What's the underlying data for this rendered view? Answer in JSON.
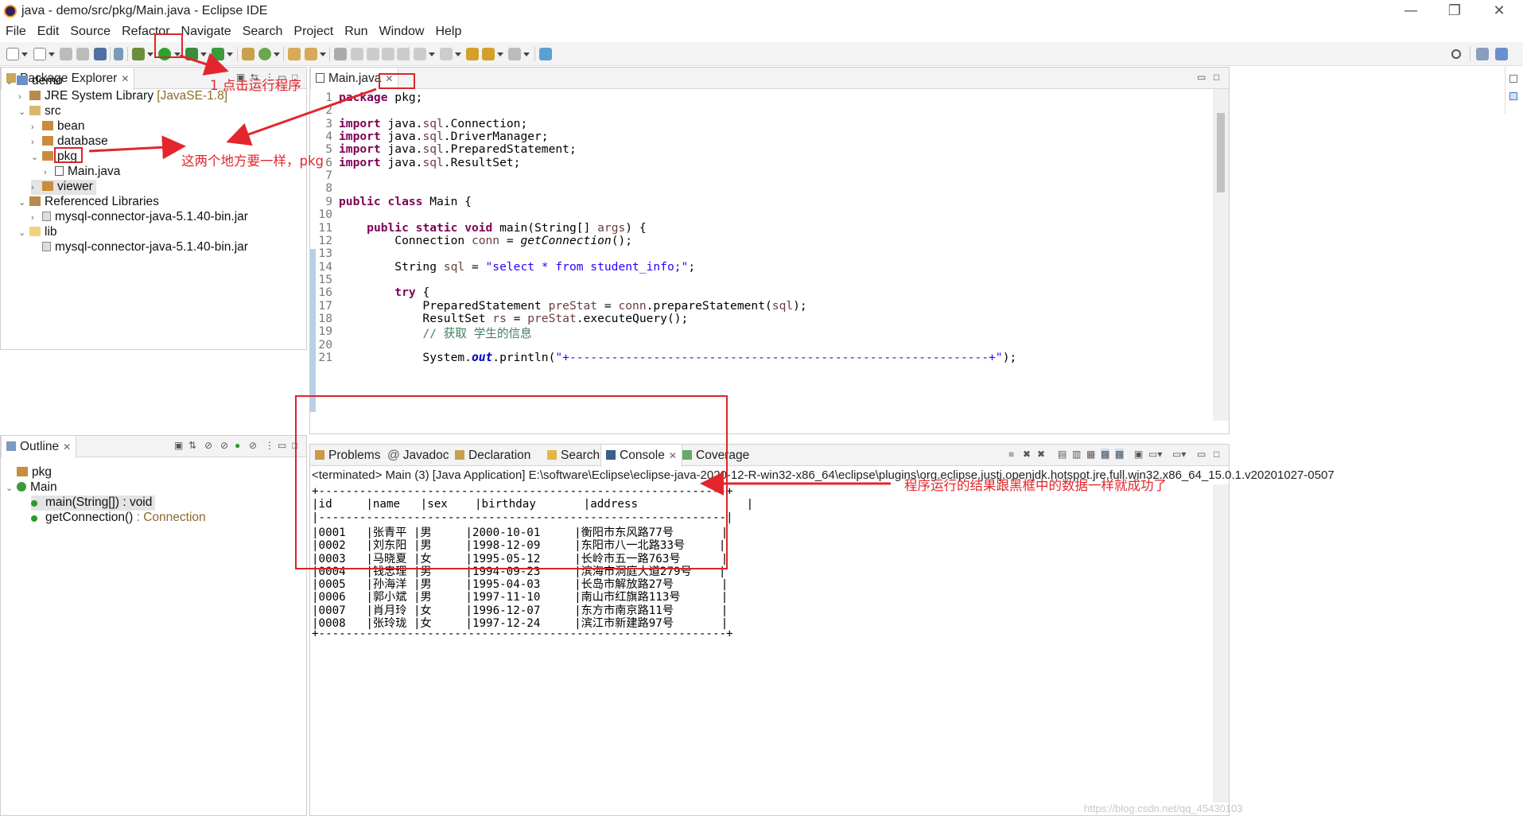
{
  "window": {
    "title": "java - demo/src/pkg/Main.java - Eclipse IDE",
    "minimize": "—",
    "maximize": "❐",
    "close": "✕"
  },
  "menu": [
    "File",
    "Edit",
    "Source",
    "Refactor",
    "Navigate",
    "Search",
    "Project",
    "Run",
    "Window",
    "Help"
  ],
  "package_explorer": {
    "tab": "Package Explorer",
    "items": [
      {
        "label": "demo",
        "extra": ""
      },
      {
        "label": "JRE System Library",
        "extra": " [JavaSE-1.8]"
      },
      {
        "label": "src",
        "extra": ""
      },
      {
        "label": "bean",
        "extra": ""
      },
      {
        "label": "database",
        "extra": ""
      },
      {
        "label": "pkg",
        "extra": ""
      },
      {
        "label": "Main.java",
        "extra": ""
      },
      {
        "label": "viewer",
        "extra": ""
      },
      {
        "label": "Referenced Libraries",
        "extra": ""
      },
      {
        "label": "mysql-connector-java-5.1.40-bin.jar",
        "extra": ""
      },
      {
        "label": "lib",
        "extra": ""
      },
      {
        "label": "mysql-connector-java-5.1.40-bin.jar",
        "extra": ""
      }
    ]
  },
  "outline": {
    "tab": "Outline",
    "items": [
      {
        "label": "pkg",
        "extra": ""
      },
      {
        "label": "Main",
        "extra": ""
      },
      {
        "label": "main(String[]) : void",
        "extra": ""
      },
      {
        "label": "getConnection()",
        "extra": " : Connection"
      }
    ]
  },
  "editor": {
    "tab": "Main.java",
    "lines": [
      {
        "n": "1",
        "code": "package pkg;"
      },
      {
        "n": "2",
        "code": ""
      },
      {
        "n": "3",
        "code": "import java.sql.Connection;"
      },
      {
        "n": "4",
        "code": "import java.sql.DriverManager;"
      },
      {
        "n": "5",
        "code": "import java.sql.PreparedStatement;"
      },
      {
        "n": "6",
        "code": "import java.sql.ResultSet;"
      },
      {
        "n": "7",
        "code": ""
      },
      {
        "n": "8",
        "code": ""
      },
      {
        "n": "9",
        "code": "public class Main {"
      },
      {
        "n": "10",
        "code": ""
      },
      {
        "n": "11",
        "code": "    public static void main(String[] args) {"
      },
      {
        "n": "12",
        "code": "        Connection conn = getConnection();"
      },
      {
        "n": "13",
        "code": ""
      },
      {
        "n": "14",
        "code": "        String sql = \"select * from student_info;\";"
      },
      {
        "n": "15",
        "code": ""
      },
      {
        "n": "16",
        "code": "        try {"
      },
      {
        "n": "17",
        "code": "            PreparedStatement preStat = conn.prepareStatement(sql);"
      },
      {
        "n": "18",
        "code": "            ResultSet rs = preStat.executeQuery();"
      },
      {
        "n": "19",
        "code": "            // 获取 学生的信息"
      },
      {
        "n": "20",
        "code": ""
      },
      {
        "n": "21",
        "code": "            System.out.println(\"+------------------------------------------------------------+\");"
      }
    ]
  },
  "bottom_tabs": [
    "Problems",
    "Javadoc",
    "Declaration",
    "Search",
    "Console",
    "Coverage"
  ],
  "console": {
    "header": "<terminated> Main (3) [Java Application] E:\\software\\Eclipse\\eclipse-java-2020-12-R-win32-x86_64\\eclipse\\plugins\\org.eclipse.justj.openjdk.hotspot.jre.full.win32.x86_64_15.0.1.v20201027-0507",
    "border": "+------------------------------------------------------------+",
    "separator": "|------------------------------------------------------------|",
    "columns": [
      "id",
      "name",
      "sex",
      "birthday",
      "address"
    ],
    "rows": [
      [
        "0001",
        "张青平",
        "男",
        "2000-10-01",
        "衡阳市东风路77号"
      ],
      [
        "0002",
        "刘东阳",
        "男",
        "1998-12-09",
        "东阳市八一北路33号"
      ],
      [
        "0003",
        "马晓夏",
        "女",
        "1995-05-12",
        "长岭市五一路763号"
      ],
      [
        "0004",
        "钱忠理",
        "男",
        "1994-09-23",
        "滨海市洞庭大道279号"
      ],
      [
        "0005",
        "孙海洋",
        "男",
        "1995-04-03",
        "长岛市解放路27号"
      ],
      [
        "0006",
        "郭小斌",
        "男",
        "1997-11-10",
        "南山市红旗路113号"
      ],
      [
        "0007",
        "肖月玲",
        "女",
        "1996-12-07",
        "东方市南京路11号"
      ],
      [
        "0008",
        "张玲珑",
        "女",
        "1997-12-24",
        "滨江市新建路97号"
      ]
    ]
  },
  "annotations": {
    "run": "1 点击运行程序",
    "same": "这两个地方要一样，pkg",
    "result": "程序运行的结果跟黑框中的数据一样就成功了"
  },
  "watermark": "https://blog.csdn.net/qq_45430103",
  "colors": {
    "annotation": "#e3262b",
    "keyword": "#7f0055",
    "string": "#2a00ff",
    "comment": "#3f7f5f"
  }
}
